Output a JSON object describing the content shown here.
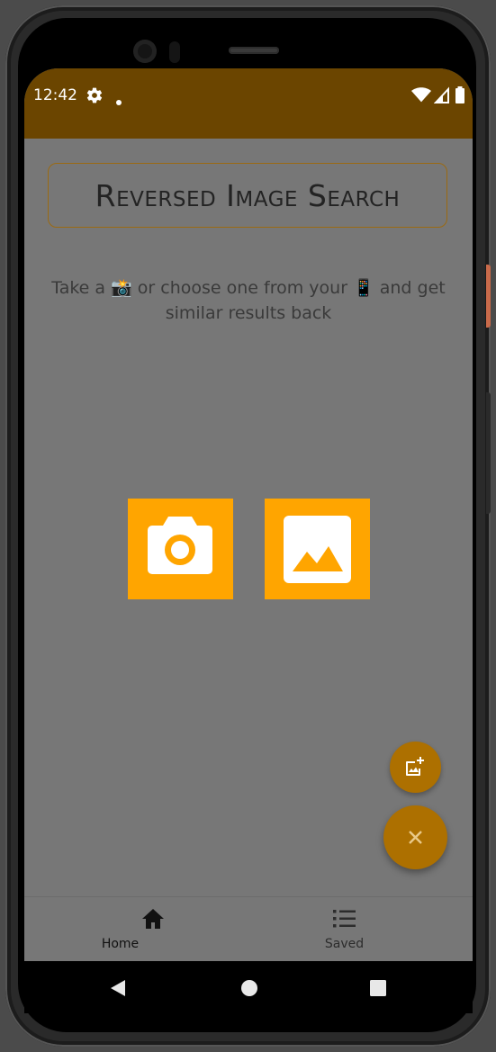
{
  "status_bar": {
    "time": "12:42",
    "icons": [
      "gear-icon",
      "notification-dot-icon",
      "wifi-icon",
      "signal-icon",
      "battery-icon"
    ],
    "background": "#6b4500"
  },
  "header": {
    "title": "Reversed Image Search"
  },
  "main": {
    "subtitle": "Take a 📸 or choose one from your 📱 and get similar results back",
    "buttons": [
      {
        "name": "camera-button",
        "icon": "camera-icon"
      },
      {
        "name": "gallery-button",
        "icon": "image-icon"
      }
    ],
    "accent": "#ffa500"
  },
  "fabs": {
    "small_icon": "add-photo-icon",
    "large_icon": "close-icon",
    "color": "#ad7000"
  },
  "bottom_nav": {
    "items": [
      {
        "label": "Home",
        "icon": "home-icon"
      },
      {
        "label": "Saved",
        "icon": "list-icon"
      }
    ]
  },
  "system_nav": {
    "icons": [
      "back-icon",
      "home-circle-icon",
      "recents-icon"
    ]
  }
}
